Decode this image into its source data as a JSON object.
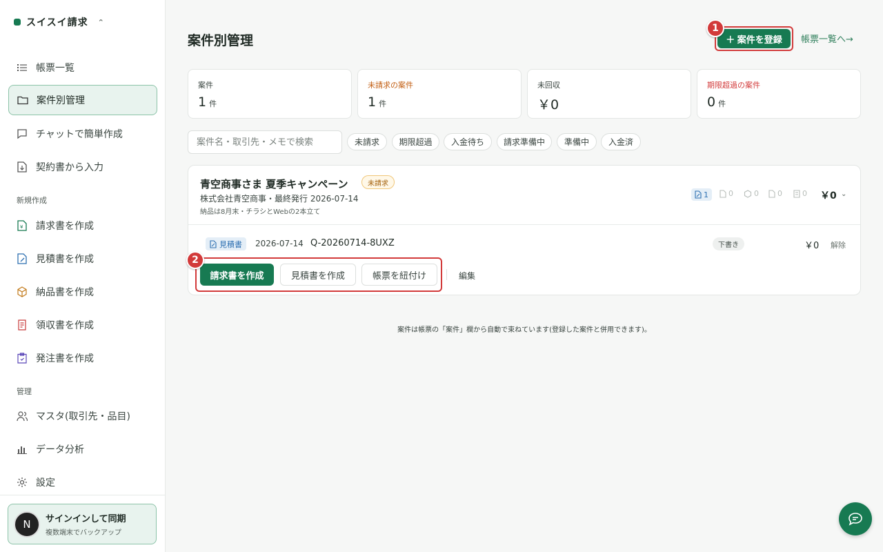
{
  "sidebar": {
    "brand": "スイスイ請求",
    "nav": [
      {
        "label": "帳票一覧",
        "icon": "list-icon"
      },
      {
        "label": "案件別管理",
        "icon": "folder-icon"
      },
      {
        "label": "チャットで簡単作成",
        "icon": "chat-icon"
      },
      {
        "label": "契約書から入力",
        "icon": "file-import-icon"
      }
    ],
    "section_new": "新規作成",
    "new_items": [
      {
        "label": "請求書を作成",
        "icon": "invoice-icon"
      },
      {
        "label": "見積書を作成",
        "icon": "estimate-icon"
      },
      {
        "label": "納品書を作成",
        "icon": "box-icon"
      },
      {
        "label": "領収書を作成",
        "icon": "receipt-icon"
      },
      {
        "label": "発注書を作成",
        "icon": "clipboard-icon"
      }
    ],
    "section_manage": "管理",
    "manage_items": [
      {
        "label": "マスタ(取引先・品目)",
        "icon": "users-icon"
      },
      {
        "label": "データ分析",
        "icon": "bar-chart-icon"
      },
      {
        "label": "設定",
        "icon": "gear-icon"
      }
    ],
    "signin": {
      "avatar": "N",
      "title": "サインインして同期",
      "subtitle": "複数端末でバックアップ"
    }
  },
  "header": {
    "title": "案件別管理",
    "add_button": "＋ 案件を登録",
    "doc_list_link": "帳票一覧へ→",
    "annotation_1": "1",
    "annotation_2": "2"
  },
  "stats": [
    {
      "label": "案件",
      "value": "1",
      "unit": "件",
      "tone": "normal"
    },
    {
      "label": "未請求の案件",
      "value": "1",
      "unit": "件",
      "tone": "warn"
    },
    {
      "label": "未回収",
      "value": "￥0",
      "unit": "",
      "tone": "normal"
    },
    {
      "label": "期限超過の案件",
      "value": "0",
      "unit": "件",
      "tone": "danger"
    }
  ],
  "search": {
    "placeholder": "案件名・取引先・メモで検索"
  },
  "filters": [
    "未請求",
    "期限超過",
    "入金待ち",
    "請求準備中",
    "準備中",
    "入金済"
  ],
  "case": {
    "name": "青空商事さま 夏季キャンペーン",
    "status": "未請求",
    "meta": "株式会社青空商事・最終発行 2026-07-14",
    "note": "納品は8月末・チラシとWebの2本立て",
    "counts": [
      "1",
      "0",
      "0",
      "0",
      "0"
    ],
    "total": "￥0",
    "document": {
      "type": "見積書",
      "date": "2026-07-14",
      "number": "Q-20260714-8UXZ",
      "status": "下書き",
      "amount": "￥0",
      "unlink": "解除"
    },
    "actions": {
      "create_invoice": "請求書を作成",
      "create_estimate": "見積書を作成",
      "link_document": "帳票を紐付け",
      "edit": "編集"
    }
  },
  "footer_note": "案件は帳票の「案件」欄から自動で束ねています(登録した案件と併用できます)。",
  "colors": {
    "accent": "#177a52",
    "annotation": "#d23a3a",
    "warn": "#c25e12",
    "info": "#2c6fb1"
  }
}
